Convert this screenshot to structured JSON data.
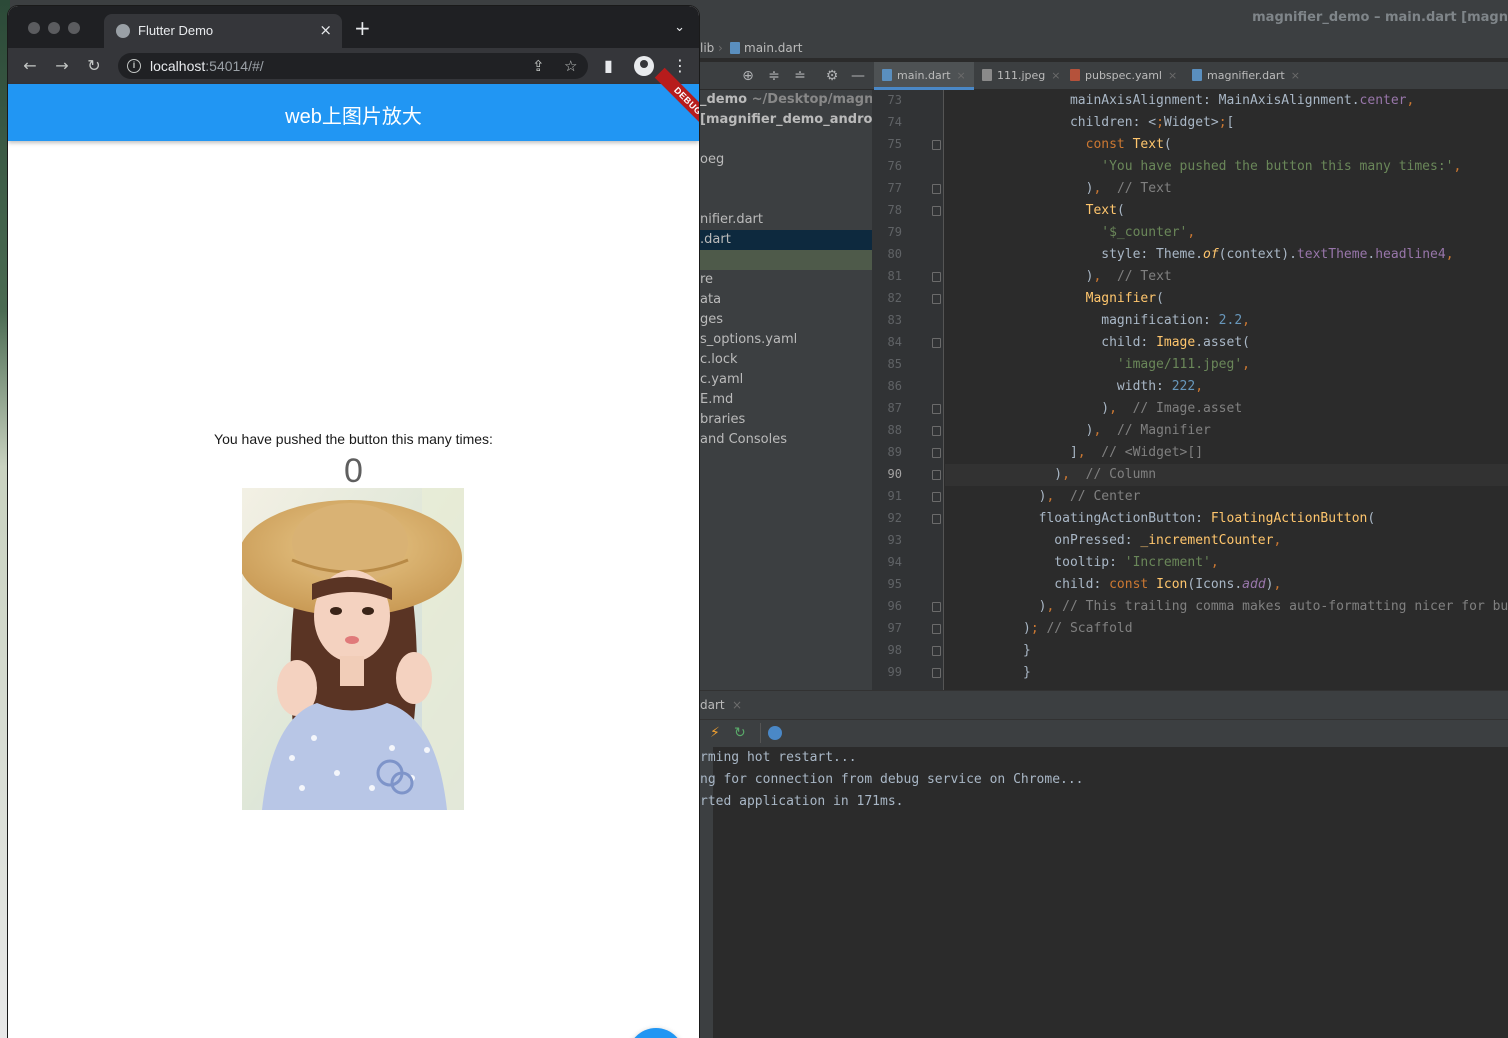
{
  "ide": {
    "title": "magnifier_demo – main.dart [magn",
    "breadcrumb": [
      "lib",
      "main.dart"
    ],
    "editor_tabs": [
      {
        "label": "main.dart",
        "active": true,
        "icon": "dart-file-icon"
      },
      {
        "label": "111.jpeg",
        "active": false,
        "icon": "image-file-icon"
      },
      {
        "label": "pubspec.yaml",
        "active": false,
        "icon": "yaml-file-icon"
      },
      {
        "label": "magnifier.dart",
        "active": false,
        "icon": "dart-file-icon"
      }
    ],
    "project_tree": [
      {
        "label": "_demo",
        "hint": " ~/Desktop/magnifier",
        "bold": true
      },
      {
        "label": " [magnifier_demo_androic",
        "hint": "",
        "bold": true
      },
      {
        "label": "",
        "hint": ""
      },
      {
        "label": "oeg",
        "hint": ""
      },
      {
        "label": "",
        "hint": ""
      },
      {
        "label": "",
        "hint": ""
      },
      {
        "label": "nifier.dart",
        "hint": ""
      },
      {
        "label": ".dart",
        "hint": "",
        "selected": true
      },
      {
        "label": "",
        "hint": "",
        "selected2": true
      },
      {
        "label": "re",
        "hint": ""
      },
      {
        "label": "ata",
        "hint": ""
      },
      {
        "label": "ges",
        "hint": ""
      },
      {
        "label": "s_options.yaml",
        "hint": ""
      },
      {
        "label": "c.lock",
        "hint": ""
      },
      {
        "label": "c.yaml",
        "hint": ""
      },
      {
        "label": "E.md",
        "hint": ""
      },
      {
        "label": "braries",
        "hint": ""
      },
      {
        "label": "and Consoles",
        "hint": ""
      }
    ],
    "line_numbers": [
      "73",
      "74",
      "75",
      "76",
      "77",
      "78",
      "79",
      "80",
      "81",
      "82",
      "83",
      "84",
      "85",
      "86",
      "87",
      "88",
      "89",
      "90",
      "91",
      "92",
      "93",
      "94",
      "95",
      "96",
      "97",
      "98",
      "99"
    ],
    "current_line": "90",
    "code_lines": [
      "      mainAxisAlignment: MainAxisAlignment.center,",
      "      children: <Widget>[",
      "        const Text(",
      "          'You have pushed the button this many times:',",
      "        ),  // Text",
      "        Text(",
      "          '$_counter',",
      "          style: Theme.of(context).textTheme.headline4,",
      "        ),  // Text",
      "        Magnifier(",
      "          magnification: 2.2,",
      "          child: Image.asset(",
      "            'image/111.jpeg',",
      "            width: 222,",
      "          ),  // Image.asset",
      "        ),  // Magnifier",
      "      ],  // <Widget>[]",
      "    ),  // Column",
      "  ),  // Center",
      "  floatingActionButton: FloatingActionButton(",
      "    onPressed: _incrementCounter,",
      "    tooltip: 'Increment',",
      "    child: const Icon(Icons.add),",
      "  ), // This trailing comma makes auto-formatting nicer for build me",
      "); // Scaffold",
      "}",
      "}"
    ],
    "bottom_tab": "dart",
    "console": [
      "rming hot restart...",
      "ng for connection from debug service on Chrome...",
      "rted application in 171ms."
    ],
    "colors": {
      "accent": "#4a88c7",
      "bg": "#2b2b2b",
      "panel": "#3c3f41"
    }
  },
  "browser": {
    "tab_title": "Flutter Demo",
    "url_host": "localhost",
    "url_rest": ":54014/#/",
    "icons": {
      "back": "←",
      "forward": "→",
      "reload": "↻",
      "close": "×",
      "new_tab": "+",
      "tab_search": "⌄",
      "share": "⇪",
      "star": "☆",
      "sidebar": "▮",
      "menu": "⋮",
      "info": "i"
    }
  },
  "app": {
    "title": "web上图片放大",
    "debug_banner": "DEBUG",
    "push_label": "You have pushed the button this many times:",
    "counter": "0",
    "primary_color": "#2196f3"
  }
}
